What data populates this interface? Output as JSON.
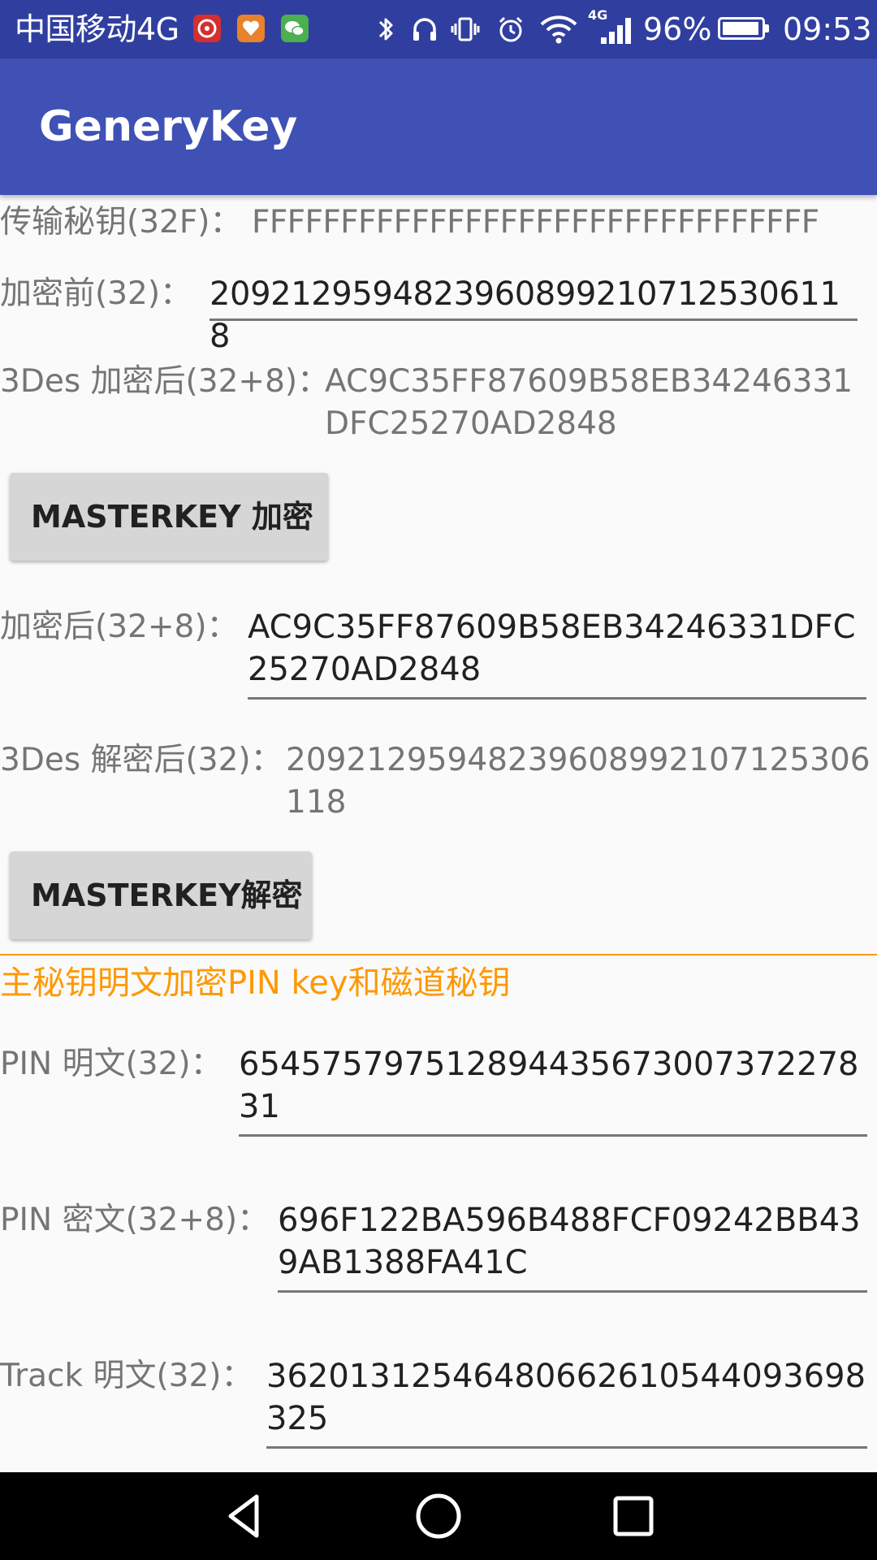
{
  "status_bar": {
    "carrier": "中国移动4G",
    "notification_icons": [
      "netease-music-icon",
      "app-notification-icon",
      "wechat-icon"
    ],
    "system_icons": [
      "bluetooth-icon",
      "headphones-icon",
      "vibrate-icon",
      "alarm-icon",
      "wifi-icon",
      "signal-4g-icon",
      "battery-icon"
    ],
    "network_badge": "4G",
    "battery_percent_text": "96%",
    "battery_level": 0.96,
    "time": "09:53"
  },
  "app_bar": {
    "title": "GeneryKey"
  },
  "fields": {
    "transfer_key": {
      "label": "传输秘钥(32F)：",
      "value": "FFFFFFFFFFFFFFFFFFFFFFFFFFFFFFFF"
    },
    "plaintext": {
      "label": "加密前(32)：",
      "value": "20921295948239608992107125306118"
    },
    "des_encrypted": {
      "label": "3Des 加密后(32+8)：",
      "value": "AC9C35FF87609B58EB34246331DFC25270AD2848"
    },
    "encrypt_button": "MASTERKEY  加密",
    "encrypted_input": {
      "label": "加密后(32+8)：",
      "value": "AC9C35FF87609B58EB34246331DFC25270AD2848"
    },
    "des_decrypted": {
      "label": "3Des 解密后(32)：",
      "value": "20921295948239608992107125306118"
    },
    "decrypt_button": "MASTERKEY解密"
  },
  "section": {
    "title": "主秘钥明文加密PIN key和磁道秘钥",
    "accent_color": "#ff9800"
  },
  "pin_fields": {
    "pin_plain": {
      "label": "PIN 明文(32)：",
      "value": "654575797512894435673007372278 31"
    },
    "pin_cipher": {
      "label": "PIN 密文(32+8)：",
      "value": "696F122BA596B488FCF09242BB439AB1388FA41C"
    },
    "track_plain": {
      "label": "Track 明文(32)：",
      "value": "36201312546480662610544093698325"
    }
  },
  "nav_bar": {
    "buttons": [
      "back-icon",
      "home-icon",
      "recents-icon"
    ]
  },
  "colors": {
    "status_bar": "#303f9f",
    "app_bar": "#3f51b5",
    "background": "#fafafa",
    "button": "#d6d6d6"
  }
}
